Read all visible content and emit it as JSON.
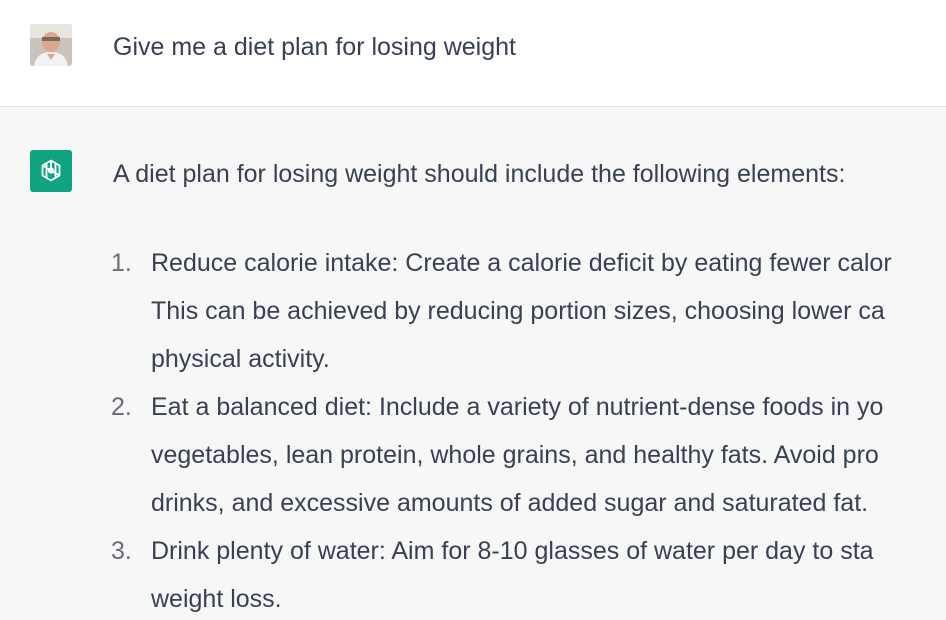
{
  "user_message": {
    "text": "Give me a diet plan for losing weight"
  },
  "assistant_message": {
    "intro": "A diet plan for losing weight should include the following elements:",
    "items": [
      {
        "number": "1.",
        "lines": [
          "Reduce calorie intake: Create a calorie deficit by eating fewer calor",
          "This can be achieved by reducing portion sizes, choosing lower ca",
          "physical activity."
        ]
      },
      {
        "number": "2.",
        "lines": [
          "Eat a balanced diet: Include a variety of nutrient-dense foods in yo",
          "vegetables, lean protein, whole grains, and healthy fats. Avoid pro",
          "drinks, and excessive amounts of added sugar and saturated fat."
        ]
      },
      {
        "number": "3.",
        "lines": [
          "Drink plenty of water: Aim for 8-10 glasses of water per day to sta",
          "weight loss."
        ]
      }
    ]
  },
  "colors": {
    "assistant_background": "#f7f7f8",
    "logo_green": "#10a37f",
    "text": "#374151"
  },
  "icons": {
    "user_avatar": "user-avatar-photo",
    "assistant_avatar": "openai-logo-icon"
  }
}
